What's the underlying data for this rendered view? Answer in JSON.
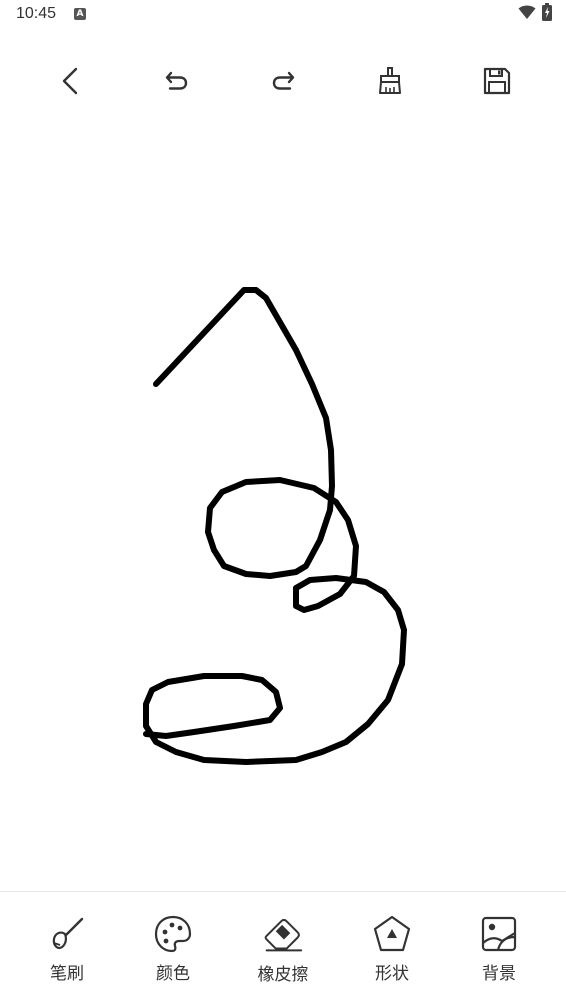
{
  "status_bar": {
    "time": "10:45",
    "notification_icon": "text-input-icon",
    "wifi_icon": "wifi-icon",
    "battery_icon": "battery-charging-icon"
  },
  "toolbar": {
    "back_icon": "chevron-left-icon",
    "undo_icon": "undo-icon",
    "redo_icon": "redo-icon",
    "clear_icon": "broom-icon",
    "save_icon": "floppy-disk-icon"
  },
  "canvas": {
    "background": "#ffffff",
    "stroke_color": "#000000"
  },
  "tools": [
    {
      "label": "笔刷",
      "icon": "brush-icon"
    },
    {
      "label": "颜色",
      "icon": "palette-icon"
    },
    {
      "label": "橡皮擦",
      "icon": "eraser-icon"
    },
    {
      "label": "形状",
      "icon": "pentagon-shape-icon"
    },
    {
      "label": "背景",
      "icon": "image-background-icon"
    }
  ]
}
